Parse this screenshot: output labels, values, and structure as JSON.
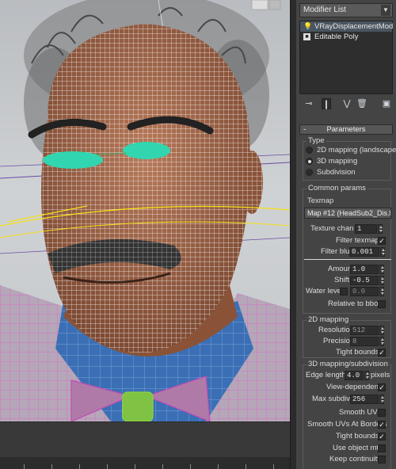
{
  "modifier_list": {
    "label": "Modifier List"
  },
  "stack": {
    "items": [
      {
        "label": "VRayDisplacementMod",
        "icon": "lightbulb-icon",
        "selected": true
      },
      {
        "label": "Editable Poly",
        "icon": "box-icon",
        "selected": false
      }
    ]
  },
  "stack_tools": [
    "pin-stack-icon",
    "show-end-result-icon",
    "make-unique-icon",
    "remove-modifier-icon",
    "configure-sets-icon"
  ],
  "parameters": {
    "title": "Parameters",
    "collapse": "-",
    "type_group": {
      "title": "Type",
      "options": [
        "2D mapping (landscape)",
        "3D mapping",
        "Subdivision"
      ],
      "selected": "3D mapping"
    },
    "common": {
      "title": "Common params",
      "texmap_label": "Texmap",
      "texmap_value": "Map #12 (HeadSub2_Dis.PSD)",
      "texture_chan_label": "Texture chan",
      "texture_chan_value": "1",
      "filter_texmap_label": "Filter texmap",
      "filter_texmap_checked": "✓",
      "filter_blur_label": "Filter blur",
      "filter_blur_value": "0.001",
      "amount_label": "Amount",
      "amount_value": "1.0",
      "shift_label": "Shift",
      "shift_value": "-0.5",
      "water_level_label": "Water level",
      "water_level_value": "0.0",
      "relative_bbox_label": "Relative to bbox"
    },
    "mapping2d": {
      "title": "2D mapping",
      "resolution_label": "Resolution",
      "resolution_value": "512",
      "precision_label": "Precision",
      "precision_value": "8",
      "tight_bounds_label": "Tight bounds",
      "tight_bounds_checked": "✓"
    },
    "mapping3d": {
      "title": "3D mapping/subdivision",
      "edge_length_label": "Edge length",
      "edge_length_value": "4.0",
      "edge_length_unit": "pixels",
      "view_dependent_label": "View-dependent",
      "view_dependent_checked": "✓",
      "max_subdivs_label": "Max subdivs",
      "max_subdivs_value": "256",
      "smooth_uvs_label": "Smooth UVs",
      "smooth_uvs_borders_label": "Smooth UVs At Borders",
      "smooth_uvs_borders_checked": "✓",
      "tight_bounds_label": "Tight bounds",
      "tight_bounds_checked": "✓",
      "use_object_mtl_label": "Use object mtl",
      "keep_continuity_label": "Keep continuity"
    }
  },
  "colors": {
    "panel_bg": "#444444",
    "wireframe": "#ffffff",
    "skin": "#a8694c",
    "shirt": "#3b6fb5",
    "jacket_wire": "#d040c0",
    "bowtie_wire": "#c24bb4",
    "button_wire": "#8bd63f",
    "eye_selection": "#31d6b0",
    "gizmo_yellow": "#f5e21b"
  }
}
